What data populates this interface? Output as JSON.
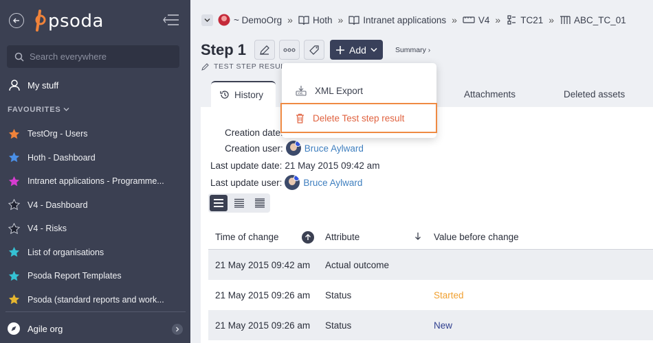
{
  "sidebar": {
    "logo_text": "psoda",
    "search_placeholder": "Search everywhere",
    "my_stuff": "My stuff",
    "favourites_heading": "FAVOURITES",
    "favourites": [
      {
        "label": "TestOrg - Users",
        "star_color": "#f0833a"
      },
      {
        "label": "Hoth - Dashboard",
        "star_color": "#4a8fe7"
      },
      {
        "label": "Intranet applications - Programme...",
        "star_color": "#d63cd0"
      },
      {
        "label": "V4 - Dashboard",
        "star_color": "#1f2230"
      },
      {
        "label": "V4 - Risks",
        "star_color": "#1f2230"
      },
      {
        "label": "List of organisations",
        "star_color": "#35c2d4"
      },
      {
        "label": "Psoda Report Templates",
        "star_color": "#35c2d4"
      },
      {
        "label": "Psoda (standard reports and work...",
        "star_color": "#e6b62f"
      }
    ],
    "org_switch": "Agile org"
  },
  "breadcrumb": [
    {
      "label": "~ DemoOrg",
      "icon": "org-avatar-icon"
    },
    {
      "label": "Hoth",
      "icon": "book-icon"
    },
    {
      "label": "Intranet applications",
      "icon": "book-icon"
    },
    {
      "label": "V4",
      "icon": "release-icon"
    },
    {
      "label": "TC21",
      "icon": "test-case-icon"
    },
    {
      "label": "ABC_TC_01",
      "icon": "test-steps-icon"
    }
  ],
  "header": {
    "title": "Step 1",
    "add_label": "Add",
    "summary_link": "Summary ›",
    "subtitle": "TEST STEP RESULT"
  },
  "tabs": {
    "history": "History",
    "attachments": "Attachments",
    "deleted_assets": "Deleted assets"
  },
  "meta": {
    "creation_date_label": "Creation date:",
    "creation_user_label": "Creation user:",
    "creation_user": "Bruce Aylward",
    "last_update_date_label": "Last update date:",
    "last_update_date": "21 May 2015 09:42 am",
    "last_update_user_label": "Last update user:",
    "last_update_user": "Bruce Aylward"
  },
  "table": {
    "headers": [
      "Time of change",
      "Attribute",
      "Value before change"
    ],
    "rows": [
      {
        "time": "21 May 2015 09:42 am",
        "attribute": "Actual outcome",
        "value": "",
        "value_color": "#2a2e3a"
      },
      {
        "time": "21 May 2015 09:26 am",
        "attribute": "Status",
        "value": "Started",
        "value_color": "#f0a030"
      },
      {
        "time": "21 May 2015 09:26 am",
        "attribute": "Status",
        "value": "New",
        "value_color": "#2f3f8f"
      }
    ]
  },
  "dropdown": {
    "xml_export": "XML Export",
    "delete": "Delete Test step result"
  },
  "colors": {
    "sidebar_bg": "#3b4052",
    "accent": "#39405a",
    "link": "#3f7fbf",
    "danger": "#e0623f",
    "highlight_border": "#ef8a42"
  }
}
